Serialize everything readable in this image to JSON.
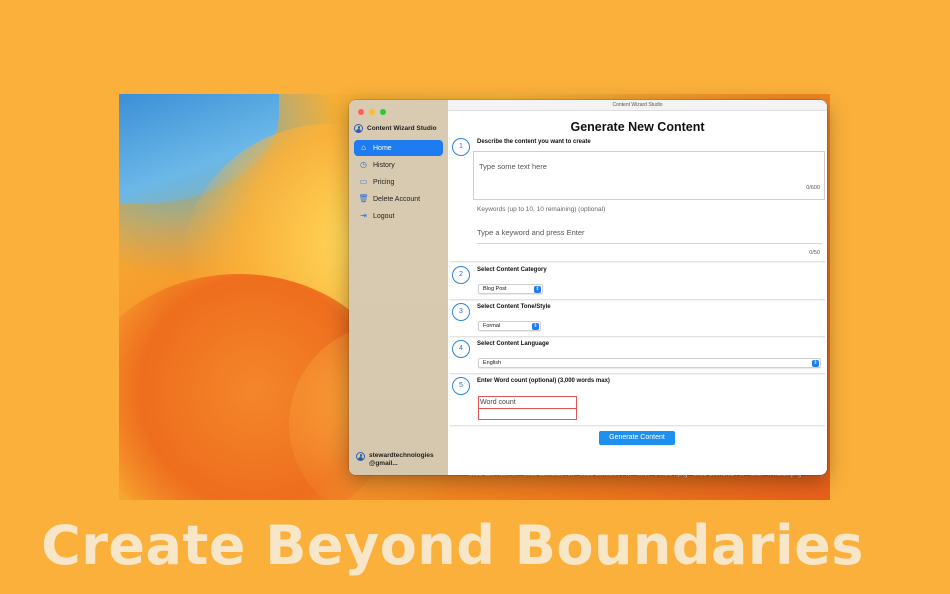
{
  "window": {
    "title": "Content Wizard Studio"
  },
  "sidebar": {
    "app_title": "Content Wizard Studio",
    "items": [
      {
        "label": "Home",
        "icon": "house-icon",
        "active": true
      },
      {
        "label": "History",
        "icon": "clock-icon",
        "active": false
      },
      {
        "label": "Pricing",
        "icon": "credit-card-icon",
        "active": false
      },
      {
        "label": "Delete Account",
        "icon": "trash-icon",
        "active": false
      },
      {
        "label": "Logout",
        "icon": "logout-icon",
        "active": false
      }
    ],
    "account": {
      "line1": "stewardtechnologies",
      "line2": "@gmail..."
    }
  },
  "main": {
    "page_title": "Generate New Content",
    "step1": {
      "number": "1",
      "label": "Describe the content you want to create",
      "placeholder": "Type some text here",
      "counter": "0/600",
      "keywords_label": "Keywords (up to 10, 10 remaining) (optional)",
      "keywords_placeholder": "Type a keyword and press Enter",
      "keywords_counter": "0/50"
    },
    "step2": {
      "number": "2",
      "label": "Select Content Category",
      "value": "Blog Post"
    },
    "step3": {
      "number": "3",
      "label": "Select Content Tone/Style",
      "value": "Formal"
    },
    "step4": {
      "number": "4",
      "label": "Select Content Language",
      "value": "English"
    },
    "step5": {
      "number": "5",
      "label": "Enter Word count (optional) (3,000 words max)",
      "placeholder": "Word count"
    },
    "generate_button": "Generate Content"
  },
  "desktop_files": [
    "2023-11...7.38 AM",
    "2023-11....2.28 AM",
    "2023-10....2.00 PM",
    "Shot - iP...1.04.png",
    "2023-10....3.01 PM",
    "Shot - iP...2.10.png"
  ],
  "tagline": "Create Beyond Boundaries",
  "colors": {
    "background": "#FBB03B",
    "accent": "#1E7CF0",
    "tagline": "#F7E6C8"
  }
}
